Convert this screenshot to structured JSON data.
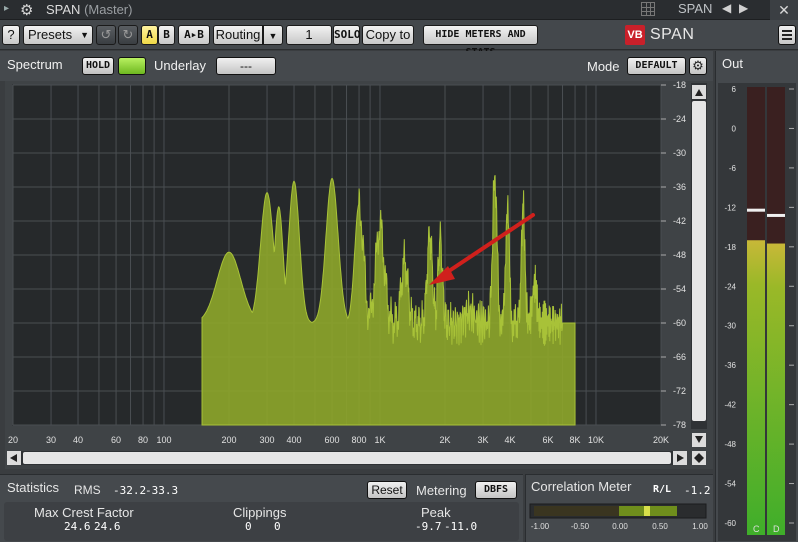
{
  "titlebar": {
    "app_name": "SPAN",
    "instance": "(Master)",
    "right_label": "SPAN",
    "prev_arrow": "◀",
    "next_arrow": "▶",
    "close": "✕"
  },
  "toolbar": {
    "help": "?",
    "presets": "Presets",
    "a": "A",
    "b": "B",
    "a_to_b": "A▸B",
    "routing": "Routing",
    "channel": "1",
    "solo": "SOLO",
    "copy_to": "Copy to",
    "hide_meters": "HIDE METERS AND STATS",
    "logo_text": "SPAN",
    "logo_mark": "VB"
  },
  "spectrum": {
    "label": "Spectrum",
    "hold": "HOLD",
    "underlay_label": "Underlay",
    "underlay_value": "---",
    "mode_label": "Mode",
    "mode_value": "DEFAULT",
    "freq_labels": [
      "20",
      "30",
      "40",
      "60",
      "80",
      "100",
      "200",
      "300",
      "400",
      "600",
      "800",
      "1K",
      "2K",
      "3K",
      "4K",
      "6K",
      "8K",
      "10K",
      "20K"
    ],
    "db_labels": [
      "-18",
      "-24",
      "-30",
      "-36",
      "-42",
      "-48",
      "-54",
      "-60",
      "-66",
      "-72",
      "-78"
    ],
    "fill_color": "#8ea62a",
    "arrow_color": "#d0201c"
  },
  "out": {
    "label": "Out",
    "scale": [
      "6",
      "0",
      "-6",
      "-12",
      "-18",
      "-24",
      "-30",
      "-36",
      "-42",
      "-48",
      "-54",
      "-60"
    ],
    "ch_left": "C",
    "ch_right": "D",
    "left_level_db": -17,
    "right_level_db": -17.5,
    "left_peak_db": -12.2,
    "right_peak_db": -13
  },
  "statistics": {
    "label": "Statistics",
    "rms_label": "RMS",
    "rms_left": "-32.2",
    "rms_right": "-33.3",
    "reset": "Reset",
    "metering_label": "Metering",
    "metering_value": "DBFS",
    "crest_label": "Max Crest Factor",
    "crest_left": "24.6",
    "crest_right": "24.6",
    "clip_label": "Clippings",
    "clip_left": "0",
    "clip_right": "0",
    "peak_label": "Peak",
    "peak_left": "-9.7",
    "peak_right": "-11.0"
  },
  "correlation": {
    "label": "Correlation Meter",
    "rl_label": "R/L",
    "rl_value": "-1.2",
    "scale": [
      "-1.00",
      "-0.50",
      "0.00",
      "0.50",
      "1.00"
    ]
  }
}
